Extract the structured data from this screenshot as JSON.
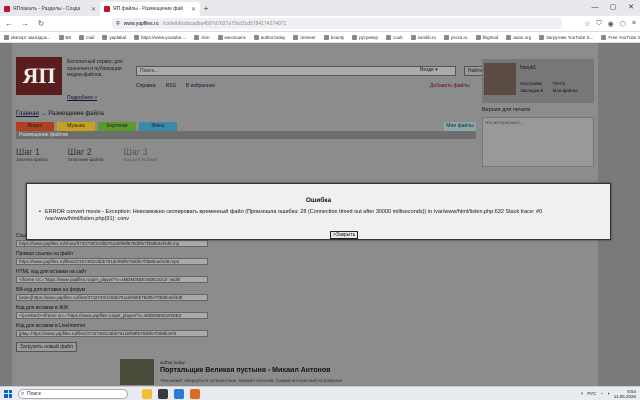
{
  "browser": {
    "tabs": [
      {
        "label": "ЯПлакалъ - Разделы - Созда",
        "active": false
      },
      {
        "label": "ЯП файлы - Размещение фай",
        "active": true
      }
    ],
    "new_tab": "+",
    "url": {
      "domain": "www.yapfiles.ru",
      "path": "/code/b6cdacadba4597d7827a79cd2cd5784174274071"
    },
    "window_controls": {
      "minimize": "—",
      "maximize": "▢",
      "close": "✕"
    }
  },
  "bookmarks": [
    "Импорт закладок...",
    "ВК",
    "mail",
    "yaplakal",
    "https://www.youtube....",
    "slon",
    "кинопоиск",
    "author.today",
    "nnmeer",
    "bounty",
    "рутрекер",
    "coub",
    "samlib.ru",
    "proza.ru",
    "libgmod",
    "autor.org",
    "Загрузчик YouTube S...",
    "Free YouTube Shorts ..."
  ],
  "site": {
    "logo_text": "ЯП",
    "tagline": "Бесплатный сервис для хранения и публикации медиа-файлов.",
    "more_link": "Подробнее »",
    "search_placeholder": "Поиск...",
    "search_scope": "Везде ▾",
    "search_button": "Найти",
    "help_links": [
      "Справка",
      "RSS",
      "В избранное"
    ],
    "add_file": "Добавить файлы",
    "user": {
      "name": "havuk1",
      "links": [
        "Настройки",
        "Почта",
        "Закладки ▾",
        "Мои файлы"
      ]
    },
    "breadcrumb": {
      "home": "Главная",
      "sep": " → ",
      "current": "Размещение файла"
    },
    "section_tabs": [
      {
        "label": "Видео",
        "color": "#b04020"
      },
      {
        "label": "Музыка",
        "color": "#c8a020"
      },
      {
        "label": "Картинки",
        "color": "#5a9a30"
      },
      {
        "label": "Флеш",
        "color": "#3a8aaa"
      }
    ],
    "my_files_tab": "Мои файлы",
    "section_header": "Размещение файлов",
    "steps": [
      {
        "num": "Шаг 1",
        "desc": "Закачка файла"
      },
      {
        "num": "Шаг 2",
        "desc": "Описание файла"
      },
      {
        "num": "Шаг 3",
        "desc": "Код для вставки"
      }
    ],
    "right_col": {
      "title": "Версия для печати",
      "box_text": "Что интересного..."
    },
    "form_fields": [
      {
        "label": "Ссылка на страницу",
        "value": "https://www.yapfiles.ru/show/3742740/2c5bb761def68f579d0fe7f358b4ef4d9.mp"
      },
      {
        "label": "Прямая ссылка на файл",
        "value": "https://www.yapfiles.ru/files/3742740/2c5bb761def68f579d0fe7f358b4ef4d9.mp4"
      },
      {
        "label": "HTML код для вставки на сайт",
        "value": "<iframe src=\"https://www.yapfiles.ru/get_player/?v=xMDM3NDIzNDE2Ocb\" width"
      },
      {
        "label": "BB-код для вставки на форум",
        "value": "[video]https://www.yapfiles.ru/files/3742740/2c5bb761def68f579d0fe7f358b4ef4d9"
      },
      {
        "label": "Код для вставки в ЖЖ",
        "value": "<lj-embed><iframe src=\"https://www.yapfiles.ru/get_player/?v=xMDM3NDIzNDE2"
      },
      {
        "label": "Код для вставки в LiveInternet",
        "value": "[play=https://www.yapfiles.ru/files/3742740/2c5bb761def68f579d0fe7f358b4ef4"
      }
    ],
    "upload_new": "Загрузить новый файл",
    "promo": {
      "source": "author.today",
      "title": "Портальщик Великая пустыня - Михаил Антонов",
      "subtitle": "Чем может обернуться путешествие. Михаил Антонов. Самый интересный из романов"
    }
  },
  "dialog": {
    "title": "Ошибка",
    "message": "ERROR convert movie - Exception: Невозможно скопировать временный файл (Произошла ошибка: 28 (Connection timed out after 30000 milliseconds)) in /var/www/html/listen.php:632 Stack trace: #0 /var/www/html/listen.php(91): conv",
    "close_button": ">Закрыть"
  },
  "taskbar": {
    "search_placeholder": "Поиск",
    "lang": "РУС",
    "time": "9:54",
    "date": "11.06.2026",
    "icon_colors": [
      "#f0c030",
      "#3a3a3a",
      "#2a7ad8",
      "#e06a20"
    ]
  }
}
